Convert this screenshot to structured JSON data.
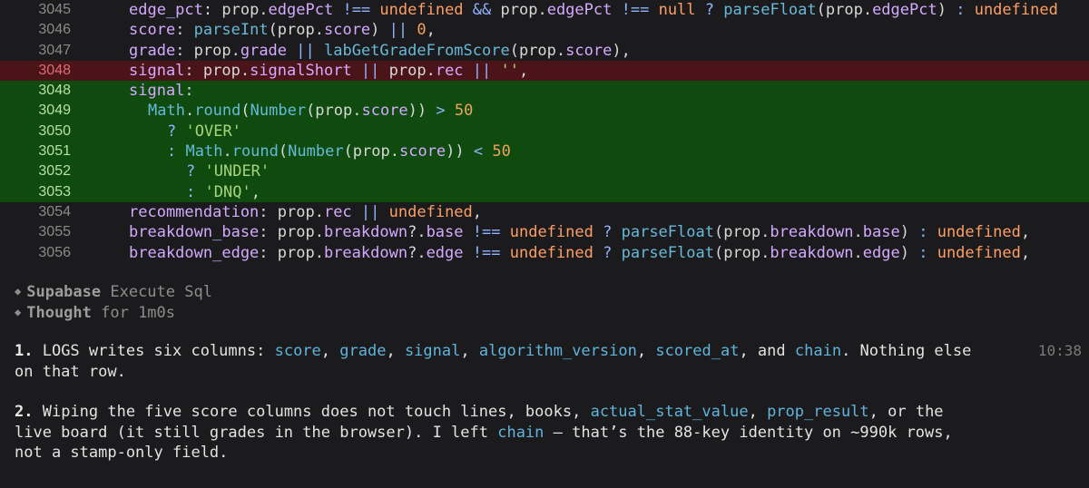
{
  "diff": {
    "lines": [
      {
        "n": "3045",
        "type": "ctx",
        "indent": 0,
        "tokens": [
          [
            "t-key",
            "edge_pct"
          ],
          [
            "t-txt",
            ": prop."
          ],
          [
            "t-key",
            "edgePct"
          ],
          [
            "t-txt",
            " "
          ],
          [
            "t-op",
            "!=="
          ],
          [
            "t-txt",
            " "
          ],
          [
            "t-kw",
            "undefined"
          ],
          [
            "t-txt",
            " "
          ],
          [
            "t-op",
            "&&"
          ],
          [
            "t-txt",
            " prop."
          ],
          [
            "t-key",
            "edgePct"
          ],
          [
            "t-txt",
            " "
          ],
          [
            "t-op",
            "!=="
          ],
          [
            "t-txt",
            " "
          ],
          [
            "t-kw",
            "null"
          ],
          [
            "t-txt",
            " "
          ],
          [
            "t-op",
            "?"
          ],
          [
            "t-txt",
            " "
          ],
          [
            "t-fn",
            "parseFloat"
          ],
          [
            "t-txt",
            "(prop."
          ],
          [
            "t-key",
            "edgePct"
          ],
          [
            "t-txt",
            ") "
          ],
          [
            "t-op",
            ":"
          ],
          [
            "t-txt",
            " "
          ],
          [
            "t-kw",
            "undefined"
          ]
        ]
      },
      {
        "n": "3046",
        "type": "ctx",
        "indent": 0,
        "tokens": [
          [
            "t-key",
            "score"
          ],
          [
            "t-txt",
            ": "
          ],
          [
            "t-fn",
            "parseInt"
          ],
          [
            "t-txt",
            "(prop."
          ],
          [
            "t-key",
            "score"
          ],
          [
            "t-txt",
            ") "
          ],
          [
            "t-op",
            "||"
          ],
          [
            "t-txt",
            " "
          ],
          [
            "t-num",
            "0"
          ],
          [
            "t-txt",
            ","
          ]
        ]
      },
      {
        "n": "3047",
        "type": "ctx",
        "indent": 0,
        "tokens": [
          [
            "t-key",
            "grade"
          ],
          [
            "t-txt",
            ": prop."
          ],
          [
            "t-key",
            "grade"
          ],
          [
            "t-txt",
            " "
          ],
          [
            "t-op",
            "||"
          ],
          [
            "t-txt",
            " "
          ],
          [
            "t-fn",
            "labGetGradeFromScore"
          ],
          [
            "t-txt",
            "(prop."
          ],
          [
            "t-key",
            "score"
          ],
          [
            "t-txt",
            "),"
          ]
        ]
      },
      {
        "n": "3048",
        "type": "del",
        "indent": 0,
        "tokens": [
          [
            "t-key",
            "signal"
          ],
          [
            "t-txt",
            ": prop."
          ],
          [
            "t-key",
            "signalShort"
          ],
          [
            "t-txt",
            " "
          ],
          [
            "t-op",
            "||"
          ],
          [
            "t-txt",
            " prop."
          ],
          [
            "t-key",
            "rec"
          ],
          [
            "t-txt",
            " "
          ],
          [
            "t-op",
            "||"
          ],
          [
            "t-txt",
            " "
          ],
          [
            "t-str",
            "''"
          ],
          [
            "t-txt",
            ","
          ]
        ]
      },
      {
        "n": "3048",
        "type": "add",
        "indent": 0,
        "tokens": [
          [
            "t-key",
            "signal"
          ],
          [
            "t-txt",
            ":"
          ]
        ]
      },
      {
        "n": "3049",
        "type": "add",
        "indent": 1,
        "tokens": [
          [
            "t-fn",
            "Math"
          ],
          [
            "t-txt",
            "."
          ],
          [
            "t-fn",
            "round"
          ],
          [
            "t-txt",
            "("
          ],
          [
            "t-fn",
            "Number"
          ],
          [
            "t-txt",
            "(prop."
          ],
          [
            "t-key",
            "score"
          ],
          [
            "t-txt",
            ")) "
          ],
          [
            "t-op",
            ">"
          ],
          [
            "t-txt",
            " "
          ],
          [
            "t-num",
            "50"
          ]
        ]
      },
      {
        "n": "3050",
        "type": "add",
        "indent": 2,
        "tokens": [
          [
            "t-op",
            "?"
          ],
          [
            "t-txt",
            " "
          ],
          [
            "t-str",
            "'OVER'"
          ]
        ]
      },
      {
        "n": "3051",
        "type": "add",
        "indent": 2,
        "tokens": [
          [
            "t-op",
            ":"
          ],
          [
            "t-txt",
            " "
          ],
          [
            "t-fn",
            "Math"
          ],
          [
            "t-txt",
            "."
          ],
          [
            "t-fn",
            "round"
          ],
          [
            "t-txt",
            "("
          ],
          [
            "t-fn",
            "Number"
          ],
          [
            "t-txt",
            "(prop."
          ],
          [
            "t-key",
            "score"
          ],
          [
            "t-txt",
            ")) "
          ],
          [
            "t-op",
            "<"
          ],
          [
            "t-txt",
            " "
          ],
          [
            "t-num",
            "50"
          ]
        ]
      },
      {
        "n": "3052",
        "type": "add",
        "indent": 3,
        "tokens": [
          [
            "t-op",
            "?"
          ],
          [
            "t-txt",
            " "
          ],
          [
            "t-str",
            "'UNDER'"
          ]
        ]
      },
      {
        "n": "3053",
        "type": "add",
        "indent": 3,
        "tokens": [
          [
            "t-op",
            ":"
          ],
          [
            "t-txt",
            " "
          ],
          [
            "t-str",
            "'DNQ'"
          ],
          [
            "t-txt",
            ","
          ]
        ]
      },
      {
        "n": "3054",
        "type": "ctx",
        "indent": 0,
        "tokens": [
          [
            "t-key",
            "recommendation"
          ],
          [
            "t-txt",
            ": prop."
          ],
          [
            "t-key",
            "rec"
          ],
          [
            "t-txt",
            " "
          ],
          [
            "t-op",
            "||"
          ],
          [
            "t-txt",
            " "
          ],
          [
            "t-kw",
            "undefined"
          ],
          [
            "t-txt",
            ","
          ]
        ]
      },
      {
        "n": "3055",
        "type": "ctx",
        "indent": 0,
        "tokens": [
          [
            "t-key",
            "breakdown_base"
          ],
          [
            "t-txt",
            ": prop."
          ],
          [
            "t-key",
            "breakdown"
          ],
          [
            "t-txt",
            "?."
          ],
          [
            "t-key",
            "base"
          ],
          [
            "t-txt",
            " "
          ],
          [
            "t-op",
            "!=="
          ],
          [
            "t-txt",
            " "
          ],
          [
            "t-kw",
            "undefined"
          ],
          [
            "t-txt",
            " "
          ],
          [
            "t-op",
            "?"
          ],
          [
            "t-txt",
            " "
          ],
          [
            "t-fn",
            "parseFloat"
          ],
          [
            "t-txt",
            "(prop."
          ],
          [
            "t-key",
            "breakdown"
          ],
          [
            "t-txt",
            "."
          ],
          [
            "t-key",
            "base"
          ],
          [
            "t-txt",
            ") "
          ],
          [
            "t-op",
            ":"
          ],
          [
            "t-txt",
            " "
          ],
          [
            "t-kw",
            "undefined"
          ],
          [
            "t-txt",
            ","
          ]
        ]
      },
      {
        "n": "3056",
        "type": "ctx",
        "indent": 0,
        "tokens": [
          [
            "t-key",
            "breakdown_edge"
          ],
          [
            "t-txt",
            ": prop."
          ],
          [
            "t-key",
            "breakdown"
          ],
          [
            "t-txt",
            "?."
          ],
          [
            "t-key",
            "edge"
          ],
          [
            "t-txt",
            " "
          ],
          [
            "t-op",
            "!=="
          ],
          [
            "t-txt",
            " "
          ],
          [
            "t-kw",
            "undefined"
          ],
          [
            "t-txt",
            " "
          ],
          [
            "t-op",
            "?"
          ],
          [
            "t-txt",
            " "
          ],
          [
            "t-fn",
            "parseFloat"
          ],
          [
            "t-txt",
            "(prop."
          ],
          [
            "t-key",
            "breakdown"
          ],
          [
            "t-txt",
            "."
          ],
          [
            "t-key",
            "edge"
          ],
          [
            "t-txt",
            ") "
          ],
          [
            "t-op",
            ":"
          ],
          [
            "t-txt",
            " "
          ],
          [
            "t-kw",
            "undefined"
          ],
          [
            "t-txt",
            ","
          ]
        ]
      }
    ]
  },
  "tools": [
    {
      "name": "Supabase",
      "rest": " Execute Sql"
    },
    {
      "name": "Thought",
      "rest": " for 1m0s"
    }
  ],
  "message": {
    "timestamp": "10:38",
    "paragraphs": [
      [
        [
          "num",
          "1."
        ],
        [
          "txt",
          " LOGS writes six columns: "
        ],
        [
          "ref",
          "score"
        ],
        [
          "txt",
          ", "
        ],
        [
          "ref",
          "grade"
        ],
        [
          "txt",
          ", "
        ],
        [
          "ref",
          "signal"
        ],
        [
          "txt",
          ", "
        ],
        [
          "ref",
          "algorithm_version"
        ],
        [
          "txt",
          ", "
        ],
        [
          "ref",
          "scored_at"
        ],
        [
          "txt",
          ", and "
        ],
        [
          "ref",
          "chain"
        ],
        [
          "txt",
          ". Nothing else\non that row."
        ]
      ],
      [
        [
          "num",
          "2."
        ],
        [
          "txt",
          " Wiping the five score columns does not touch lines, books, "
        ],
        [
          "ref",
          "actual_stat_value"
        ],
        [
          "txt",
          ", "
        ],
        [
          "ref",
          "prop_result"
        ],
        [
          "txt",
          ", or the\nlive board (it still grades in the browser). I left "
        ],
        [
          "ref",
          "chain"
        ],
        [
          "txt",
          " — that’s the 88-key identity on ~990k rows,\nnot a stamp-only field."
        ]
      ]
    ]
  }
}
